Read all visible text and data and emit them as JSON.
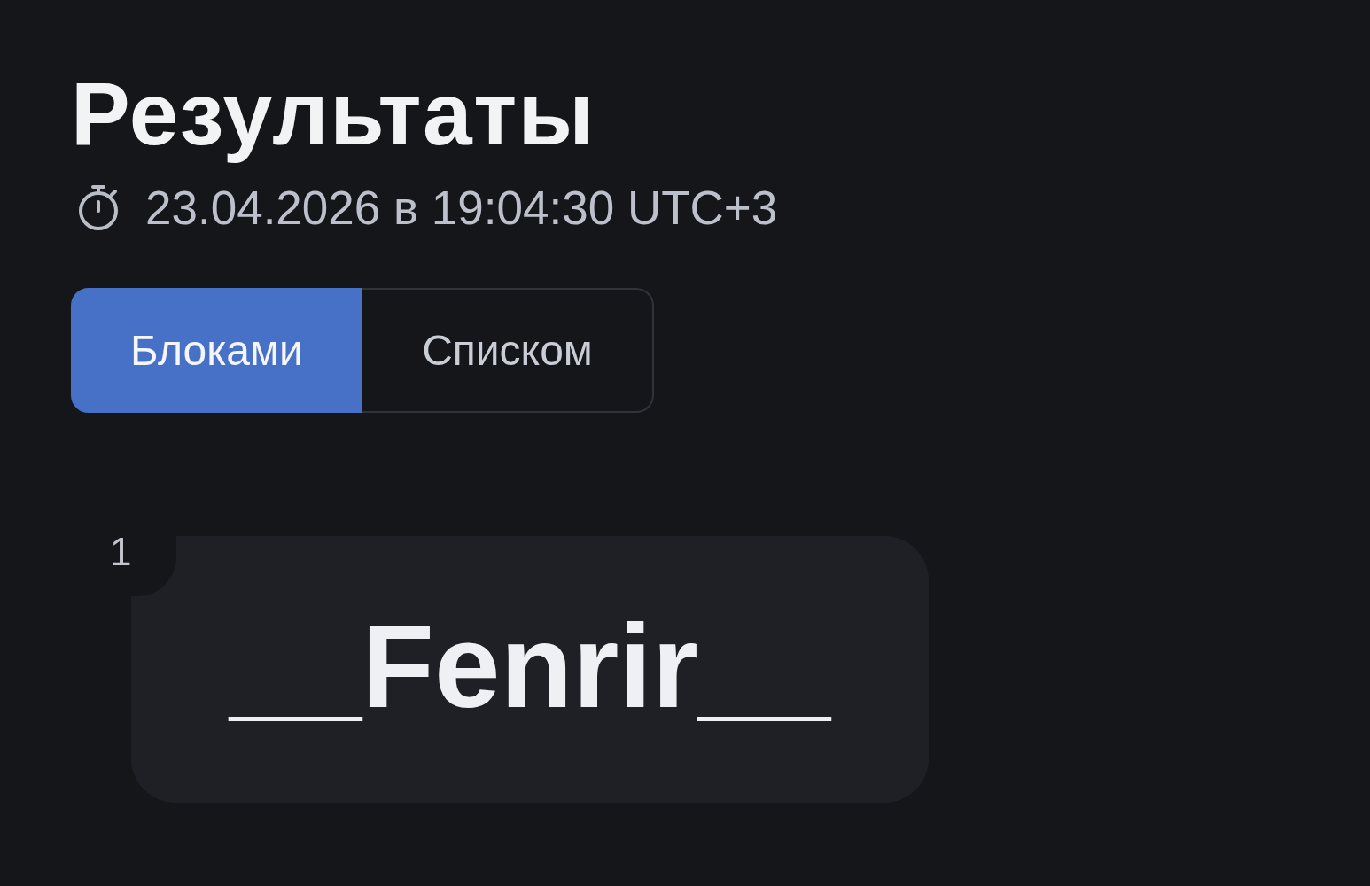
{
  "page": {
    "title": "Результаты",
    "timestamp": "23.04.2026 в 19:04:30 UTC+3"
  },
  "view_tabs": [
    {
      "label": "Блоками",
      "selected": true
    },
    {
      "label": "Списком",
      "selected": false
    }
  ],
  "results": [
    {
      "number": "1",
      "name": "__Fenrir__"
    }
  ]
}
